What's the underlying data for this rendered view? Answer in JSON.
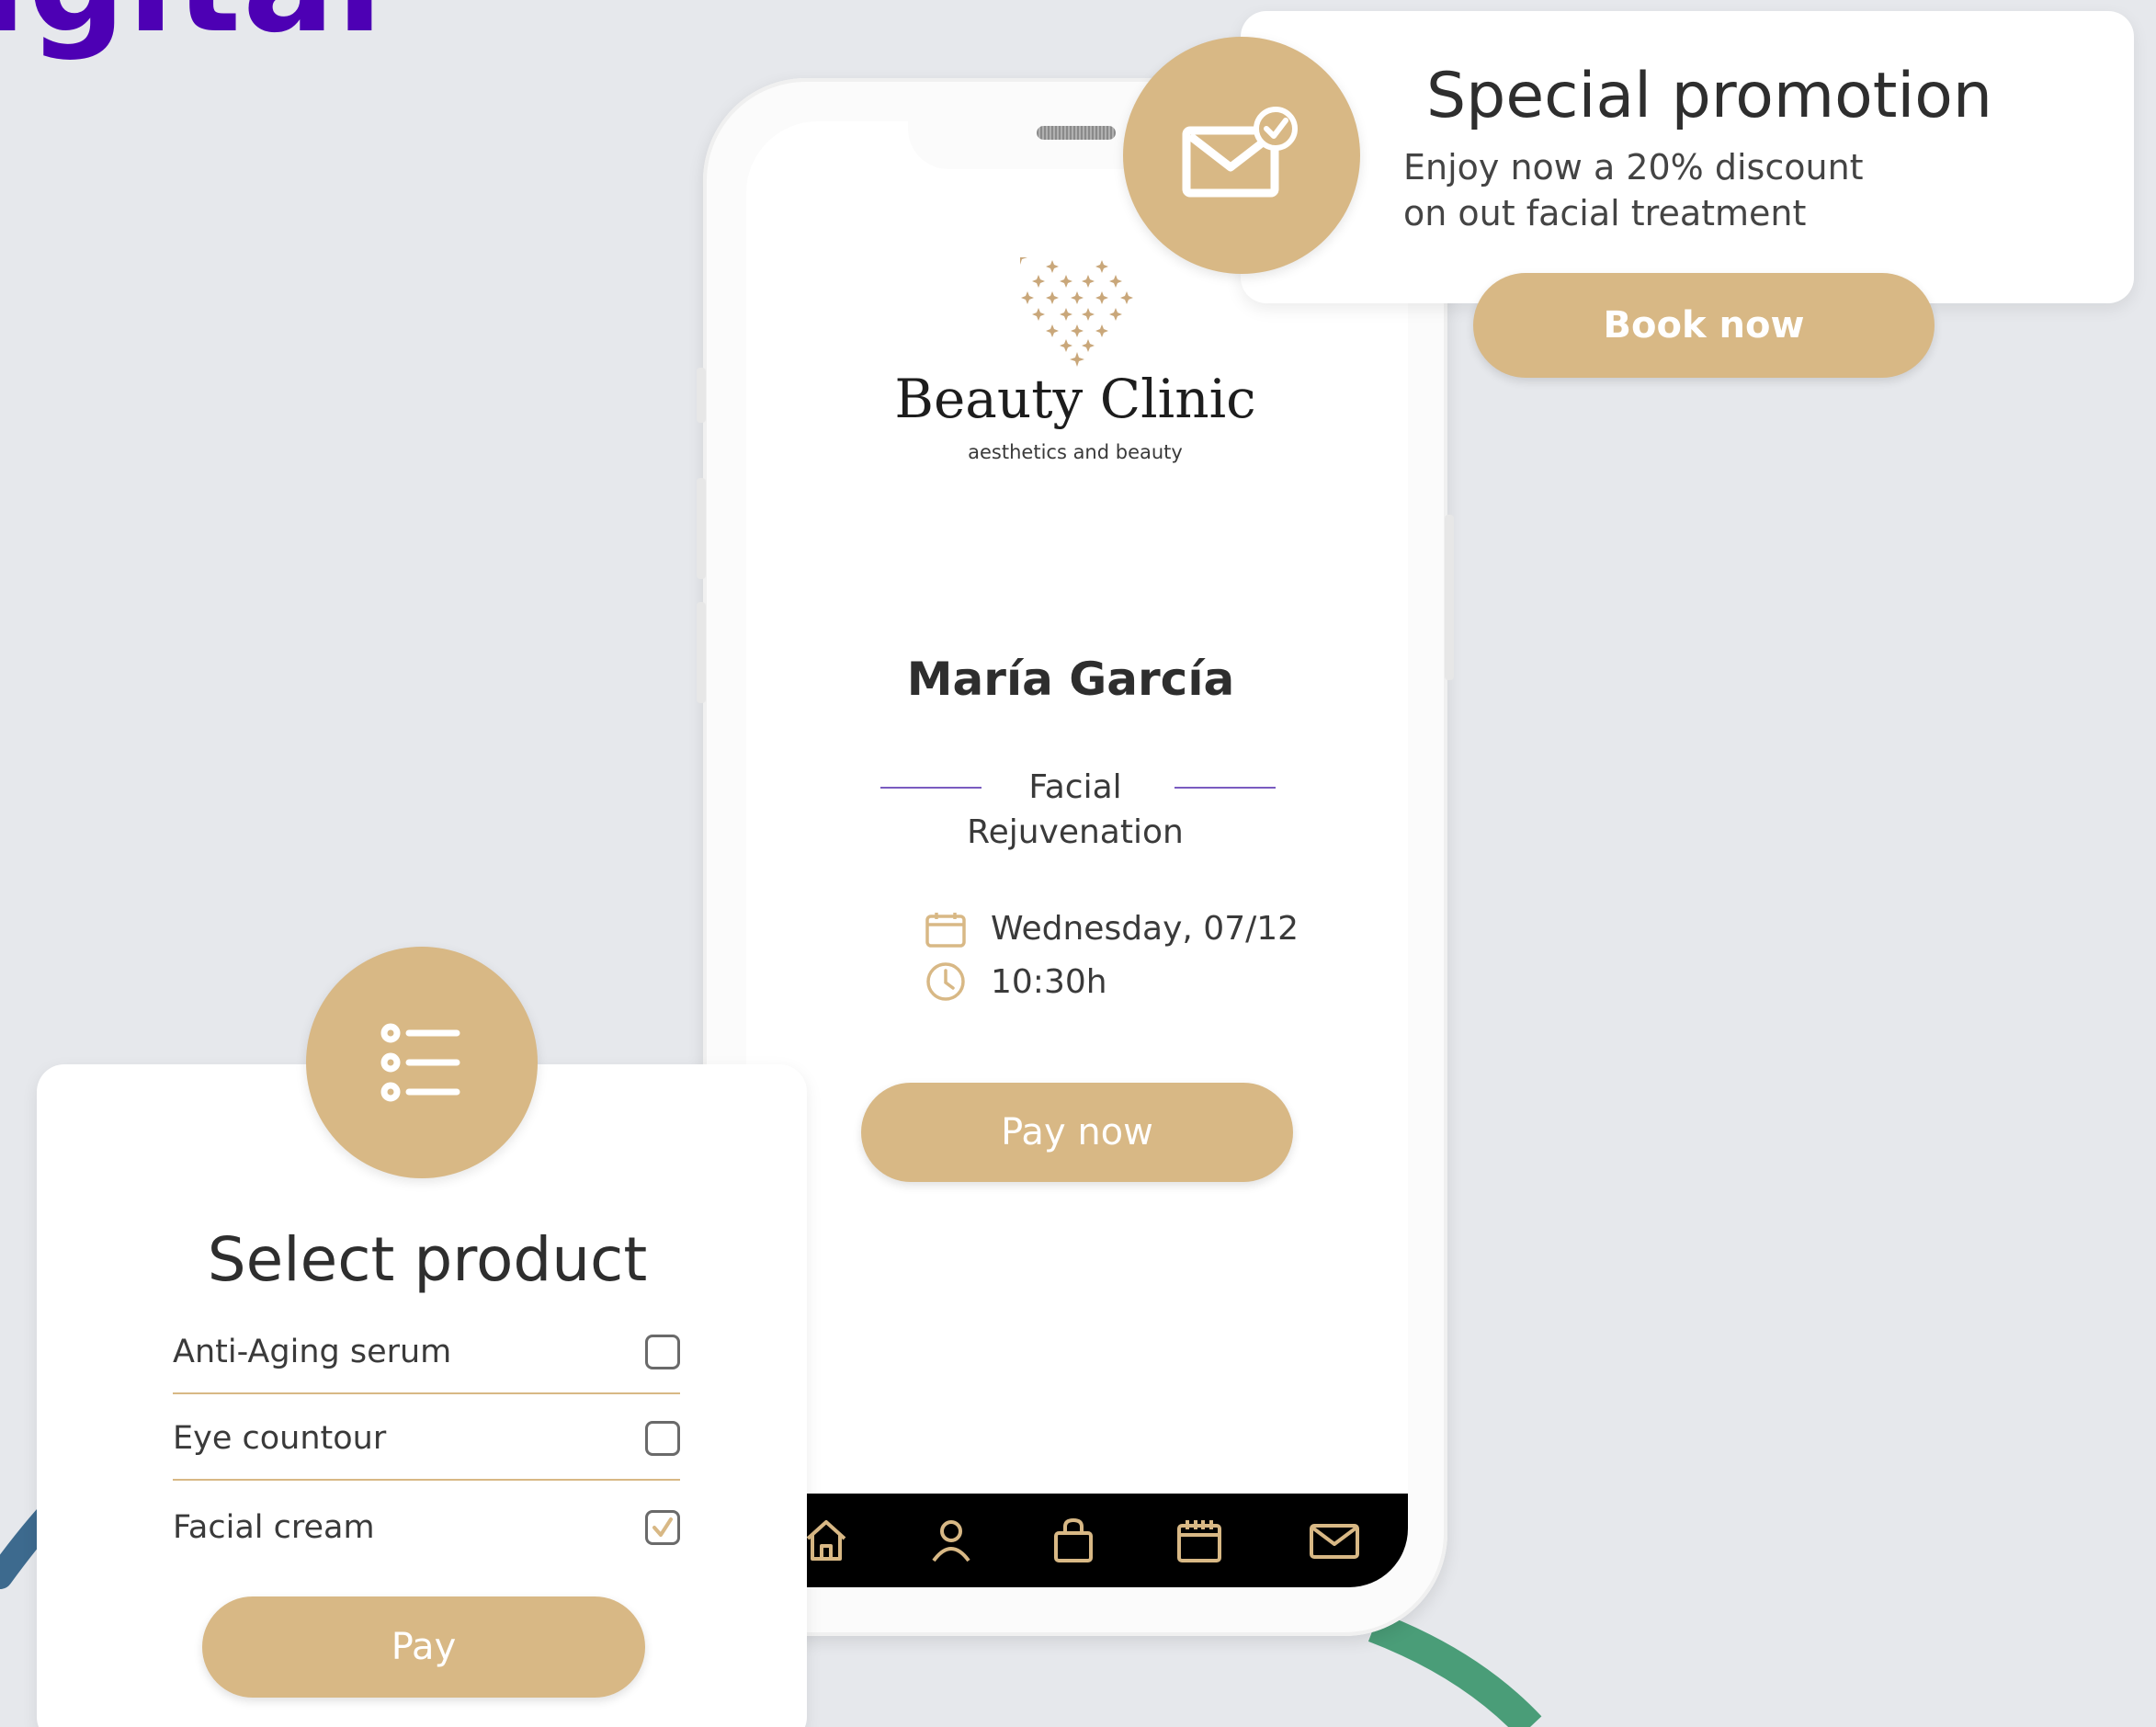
{
  "headline_fragment": "igital",
  "colors": {
    "accent_gold": "#d8b885",
    "headline_purple": "#4d00b4",
    "background": "#e6e8ec"
  },
  "phone": {
    "brand": {
      "logo_icon": "diamond-heart-logo-icon",
      "name": "Beauty Clinic",
      "tagline": "aesthetics and beauty"
    },
    "client_name": "María García",
    "treatment": [
      "Facial",
      "Rejuvenation"
    ],
    "appointment": {
      "date_icon": "calendar-icon",
      "date": "Wednesday, 07/12",
      "time_icon": "clock-icon",
      "time": "10:30h"
    },
    "pay_now_label": "Pay now",
    "nav_items": [
      "home-icon",
      "user-icon",
      "shopping-bag-icon",
      "calendar-icon",
      "mail-icon"
    ]
  },
  "promo": {
    "icon": "mail-check-icon",
    "title": "Special promotion",
    "text_line1": "Enjoy now a 20% discount",
    "text_line2": "on out facial treatment",
    "button_label": "Book now"
  },
  "product_select": {
    "icon": "list-icon",
    "title": "Select product",
    "items": [
      {
        "label": "Anti-Aging serum",
        "checked": false
      },
      {
        "label": "Eye countour",
        "checked": false
      },
      {
        "label": "Facial cream",
        "checked": true
      }
    ],
    "pay_label": "Pay"
  }
}
